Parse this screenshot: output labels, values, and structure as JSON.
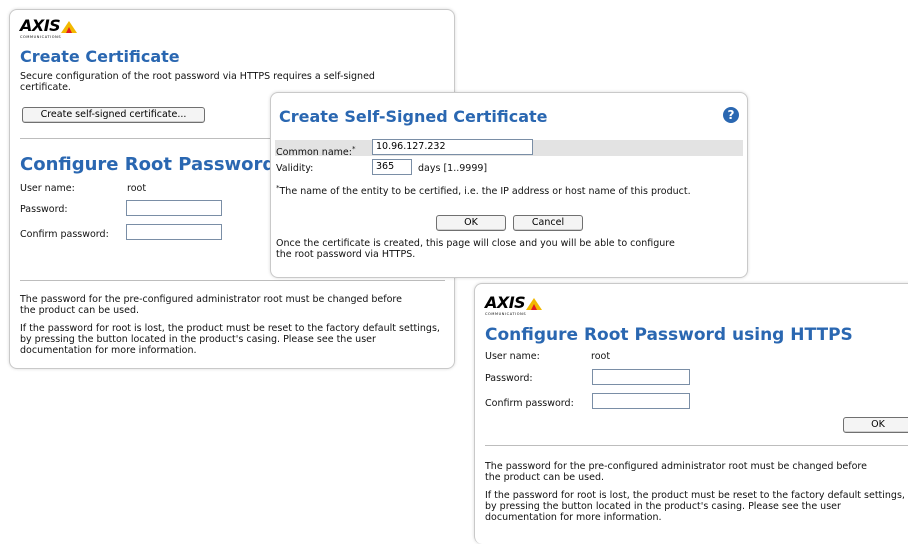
{
  "brand": {
    "logo_text": "AXIS",
    "logo_sub": "COMMUNICATIONS"
  },
  "panel_left": {
    "create_cert_title": "Create Certificate",
    "create_cert_desc": "Secure configuration of the root password via HTTPS requires a self-signed certificate.",
    "create_cert_button": "Create self-signed certificate...",
    "config_root_title": "Configure Root Password",
    "user_name_label": "User name:",
    "user_name_value": "root",
    "password_label": "Password:",
    "password_value": "",
    "confirm_label": "Confirm password:",
    "confirm_value": "",
    "note1": "The password for the pre-configured administrator root must be changed before the product can be used.",
    "note2": "If the password for root is lost, the product must be reset to the factory default settings, by pressing the button located in the product's casing. Please see the user documentation for more information."
  },
  "dialog": {
    "title": "Create Self-Signed Certificate",
    "help_icon": "?",
    "common_name_label": "Common name:",
    "common_name_marker": "*",
    "common_name_value": "10.96.127.232",
    "validity_label": "Validity:",
    "validity_value": "365",
    "validity_hint": "days [1..9999]",
    "footnote_marker": "*",
    "footnote": "The name of the entity to be certified, i.e. the IP address or host name of this product.",
    "ok_button": "OK",
    "cancel_button": "Cancel",
    "info": "Once the certificate is created, this page will close and you will be able to configure the root password via HTTPS."
  },
  "panel_right": {
    "title": "Configure Root Password using HTTPS",
    "user_name_label": "User name:",
    "user_name_value": "root",
    "password_label": "Password:",
    "password_value": "",
    "confirm_label": "Confirm password:",
    "confirm_value": "",
    "ok_button": "OK",
    "note1": "The password for the pre-configured administrator root must be changed before the product can be used.",
    "note2": "If the password for root is lost, the product must be reset to the factory default settings, by pressing the button located in the product's casing. Please see the user documentation for more information."
  },
  "colors": {
    "title_blue": "#2a67b1",
    "help_blue": "#2a67b1",
    "logo_yellow": "#f2b800",
    "logo_red": "#e21b23"
  }
}
